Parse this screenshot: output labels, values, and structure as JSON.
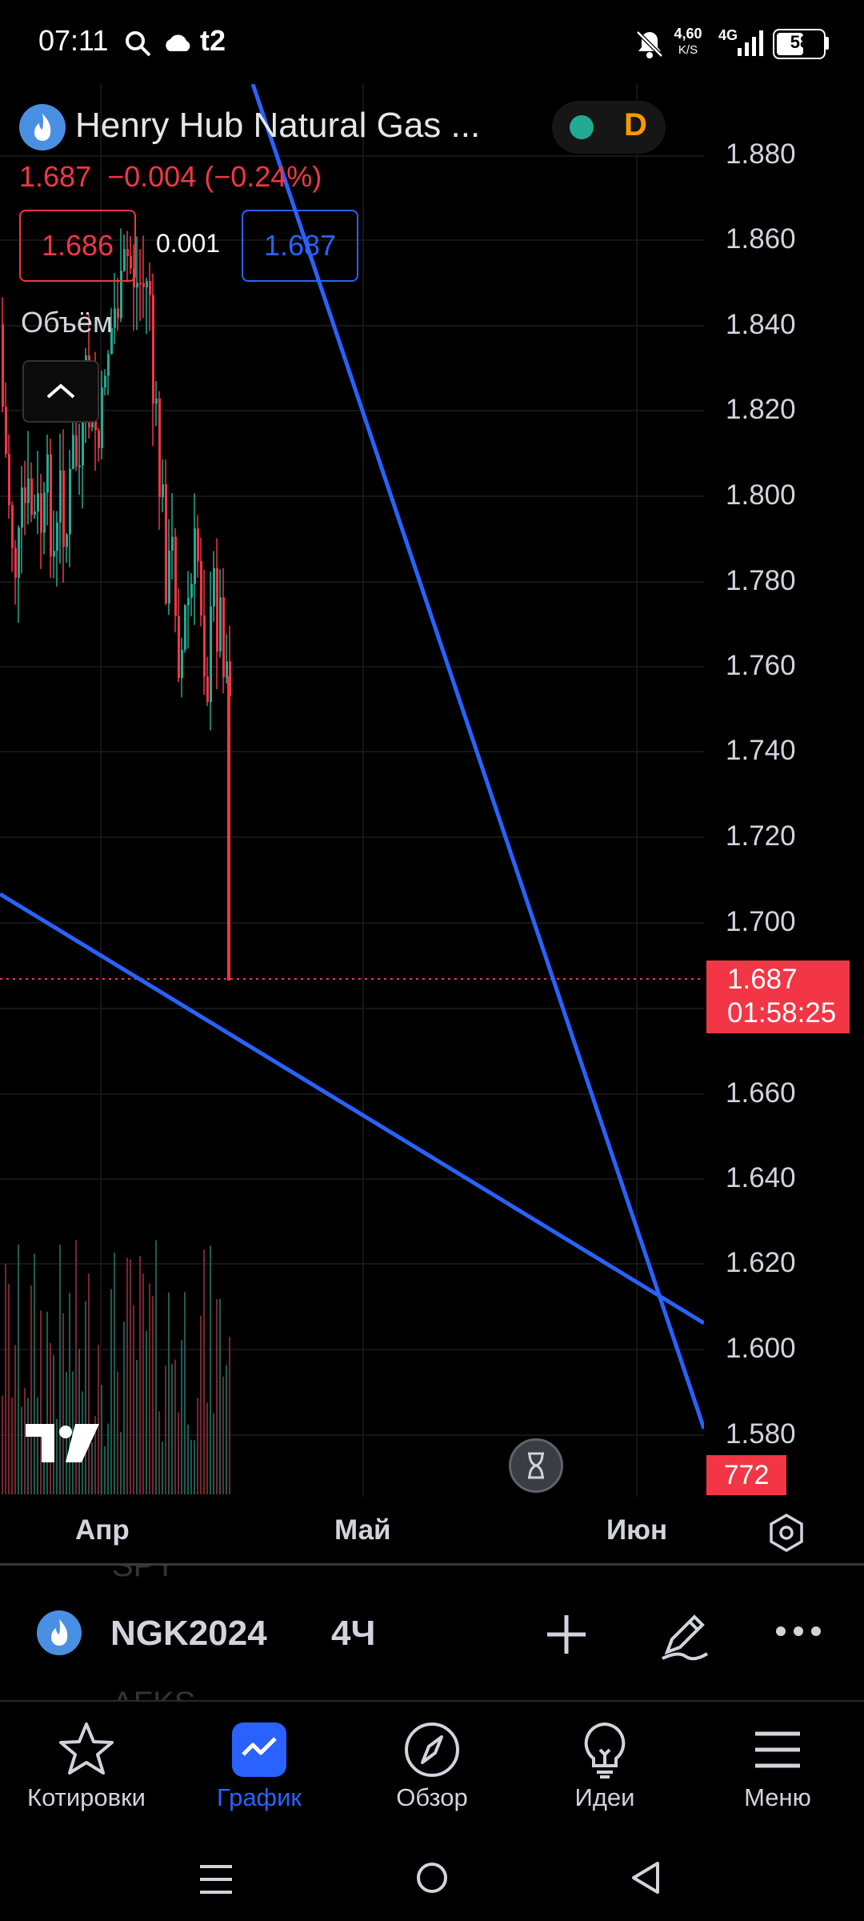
{
  "status_bar": {
    "time": "07:11",
    "carrier": "t2",
    "speed_value": "4,60",
    "speed_unit": "K/S",
    "network": "4G",
    "battery": "58"
  },
  "legend": {
    "title": "Henry Hub Natural Gas ...",
    "last_price": "1.687",
    "change": "−0.004 (−0.24%)",
    "bid": "1.686",
    "spread": "0.001",
    "ask": "1.687",
    "interval_badge": "D"
  },
  "indicator": {
    "volume_label": "Объём"
  },
  "price_scale": {
    "ticks": [
      "1.880",
      "1.860",
      "1.840",
      "1.820",
      "1.800",
      "1.780",
      "1.760",
      "1.740",
      "1.720",
      "1.700",
      "1.660",
      "1.640",
      "1.620",
      "1.600",
      "1.580"
    ],
    "current_price": "1.687",
    "countdown": "01:58:25",
    "volume_value": "772"
  },
  "time_axis": {
    "labels": [
      "Апр",
      "Май",
      "Июн"
    ]
  },
  "symbol_bar": {
    "symbol": "NGK2024",
    "interval": "4Ч",
    "bg_text_top": "SPY",
    "bg_text_bottom": "AFKS"
  },
  "bottom_nav": {
    "items": [
      {
        "label": "Котировки",
        "icon": "star-icon"
      },
      {
        "label": "График",
        "icon": "chart-icon"
      },
      {
        "label": "Обзор",
        "icon": "compass-icon"
      },
      {
        "label": "Идеи",
        "icon": "lightbulb-icon"
      },
      {
        "label": "Меню",
        "icon": "menu-icon"
      }
    ]
  },
  "colors": {
    "up": "#22ab94",
    "down": "#f23645",
    "trendline": "#2962ff",
    "accent": "#2962ff",
    "background": "#000000"
  }
}
